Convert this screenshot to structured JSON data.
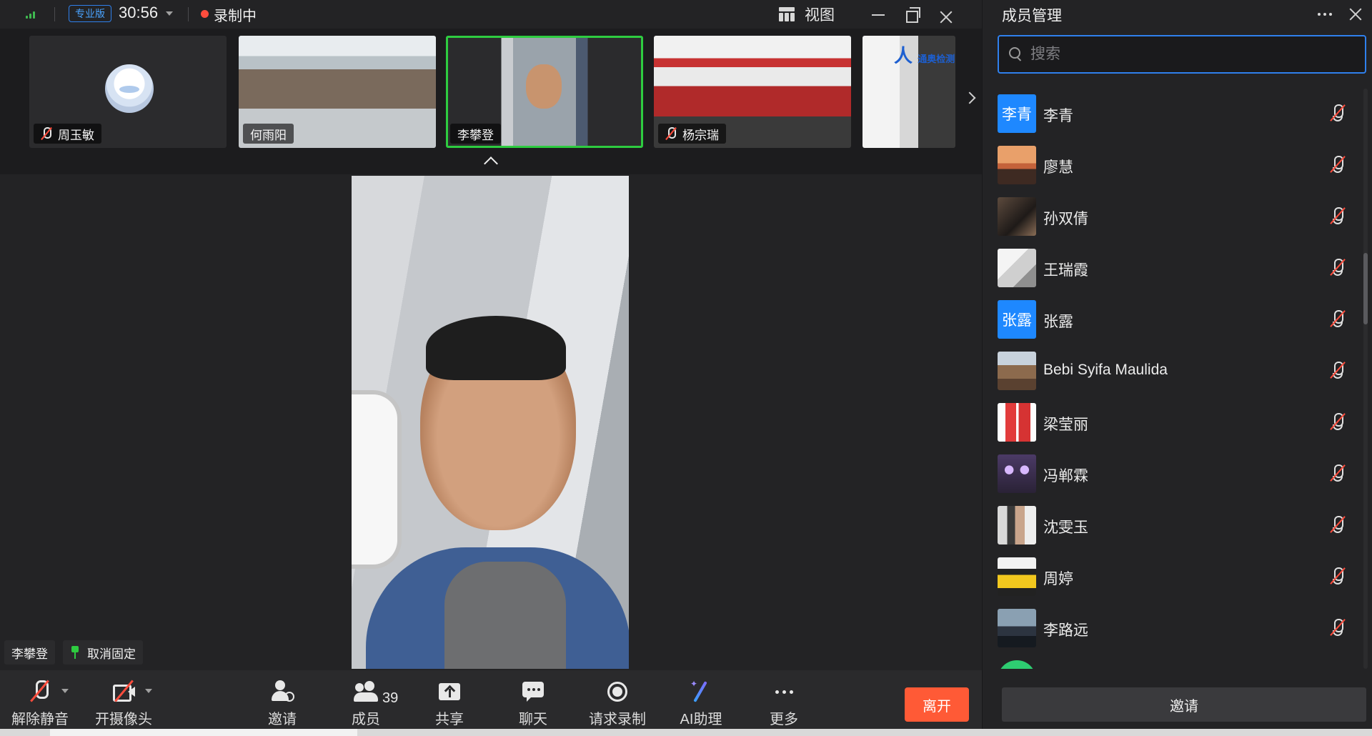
{
  "topbar": {
    "edition": "专业版",
    "timer": "30:56",
    "recording": "录制中",
    "view_label": "视图"
  },
  "thumbnails": [
    {
      "name": "周玉敏",
      "muted": true
    },
    {
      "name": "何雨阳",
      "muted": false
    },
    {
      "name": "李攀登",
      "muted": false,
      "active": true
    },
    {
      "name": "杨宗瑞",
      "muted": true
    },
    {
      "name": "",
      "muted": false
    }
  ],
  "thumb_logo": "通奥检测",
  "stage": {
    "speaker_name": "李攀登",
    "unpin_label": "取消固定"
  },
  "toolbar": {
    "unmute": "解除静音",
    "camera": "开摄像头",
    "invite": "邀请",
    "members": "成员",
    "members_count": "39",
    "share": "共享",
    "chat": "聊天",
    "request_record": "请求录制",
    "ai_assistant": "AI助理",
    "more": "更多",
    "leave": "离开"
  },
  "panel": {
    "title": "成员管理",
    "search_placeholder": "搜索",
    "invite_label": "邀请",
    "members": [
      {
        "name": "李青",
        "avatar_text": "李青",
        "avatar": "text"
      },
      {
        "name": "廖慧",
        "avatar_text": "",
        "avatar": "sunset"
      },
      {
        "name": "孙双倩",
        "avatar_text": "",
        "avatar": "dark"
      },
      {
        "name": "王瑞霞",
        "avatar_text": "",
        "avatar": "sketch"
      },
      {
        "name": "张露",
        "avatar_text": "张露",
        "avatar": "text"
      },
      {
        "name": "Bebi Syifa Maulida",
        "avatar_text": "",
        "avatar": "desk"
      },
      {
        "name": "梁莹丽",
        "avatar_text": "",
        "avatar": "couple"
      },
      {
        "name": "冯郸霖",
        "avatar_text": "",
        "avatar": "purple"
      },
      {
        "name": "沈雯玉",
        "avatar_text": "",
        "avatar": "girl"
      },
      {
        "name": "周婷",
        "avatar_text": "",
        "avatar": "yellow"
      },
      {
        "name": "李路远",
        "avatar_text": "",
        "avatar": "lake"
      },
      {
        "name": "",
        "avatar_text": "",
        "avatar": "green"
      }
    ]
  },
  "colors": {
    "accent": "#2f80ed",
    "active_border": "#2ecc40",
    "muted_red": "#ff4d3d",
    "leave": "#ff5a36"
  }
}
